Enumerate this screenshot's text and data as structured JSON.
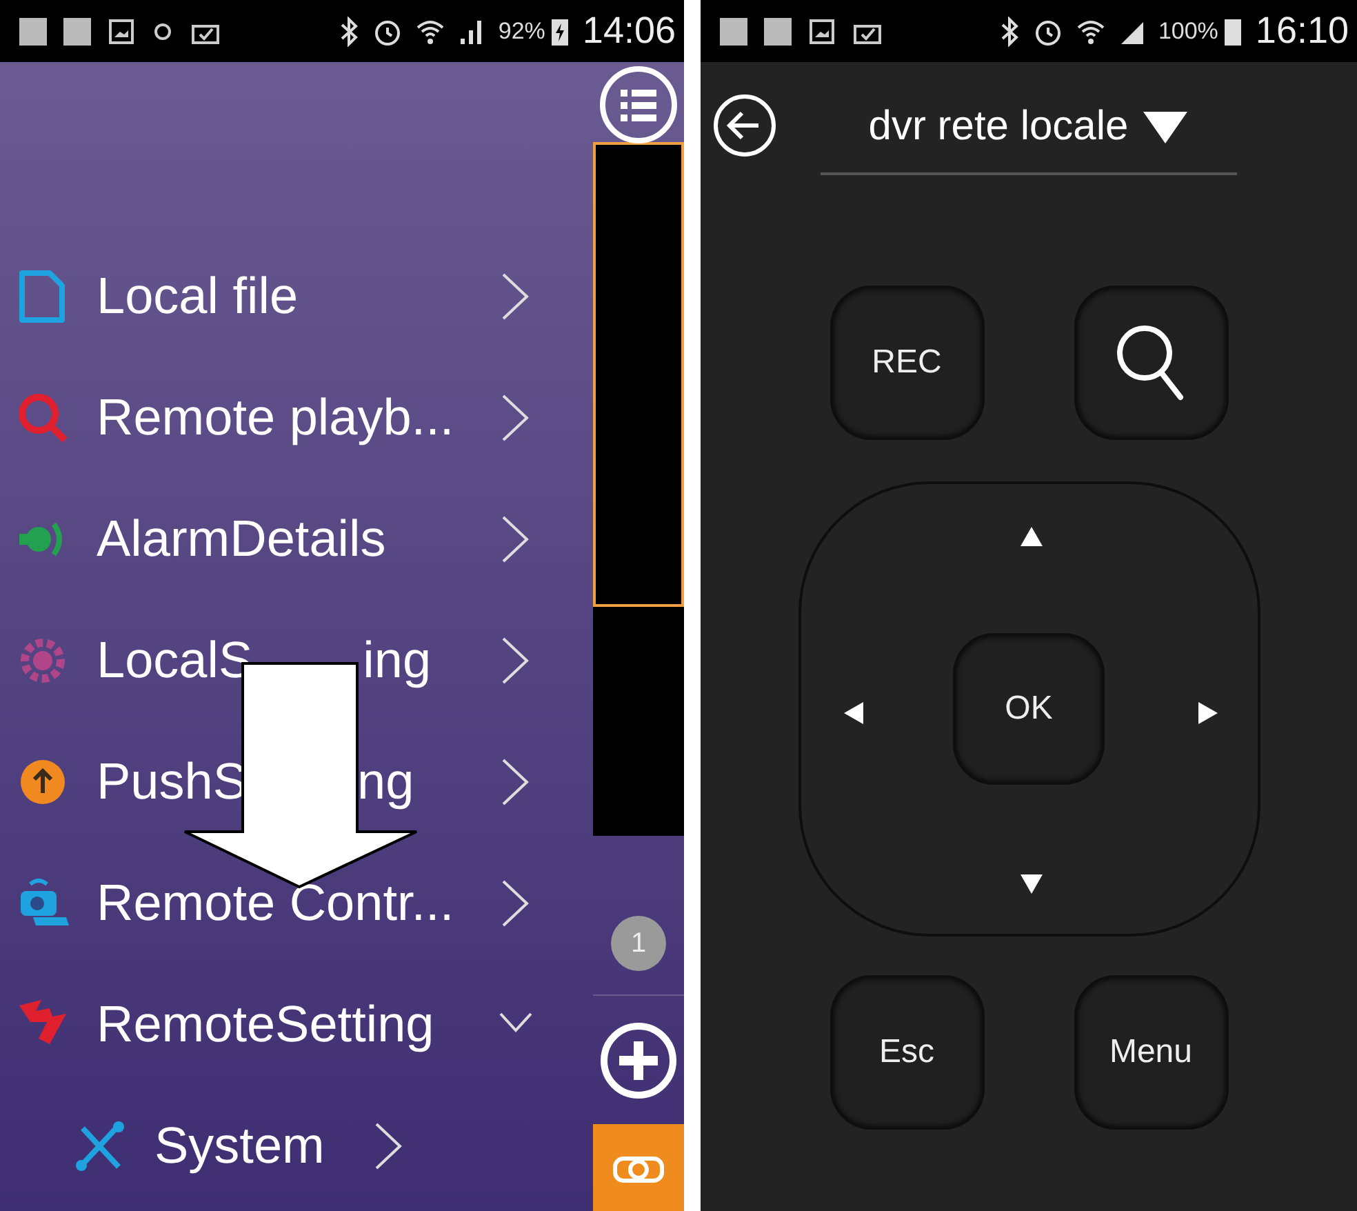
{
  "left_screen": {
    "status_bar": {
      "battery": "92%",
      "time": "14:06"
    },
    "menu_items": [
      {
        "label_parts": [
          "Local file"
        ],
        "expanded": false
      },
      {
        "label_parts": [
          "Remote playb..."
        ],
        "expanded": false
      },
      {
        "label_parts": [
          "AlarmDetails"
        ],
        "expanded": false
      },
      {
        "label_parts": [
          "LocalS",
          "ing"
        ],
        "expanded": false
      },
      {
        "label_parts": [
          "PushS",
          "ng"
        ],
        "expanded": false
      },
      {
        "label_parts": [
          "Remote Contr..."
        ],
        "expanded": false
      },
      {
        "label_parts": [
          "RemoteSetting"
        ],
        "expanded": true,
        "children": [
          {
            "label_parts": [
              "System"
            ],
            "expanded": false
          }
        ]
      }
    ],
    "badge": "1"
  },
  "right_screen": {
    "status_bar": {
      "battery": "100%",
      "time": "16:10"
    },
    "title": "dvr rete locale",
    "top_buttons": [
      {
        "kind": "text",
        "label": "REC"
      },
      {
        "kind": "search"
      }
    ],
    "ok_label": "OK",
    "bottom_buttons": [
      {
        "kind": "text",
        "label": "Esc"
      },
      {
        "kind": "text",
        "label": "Menu"
      }
    ]
  }
}
